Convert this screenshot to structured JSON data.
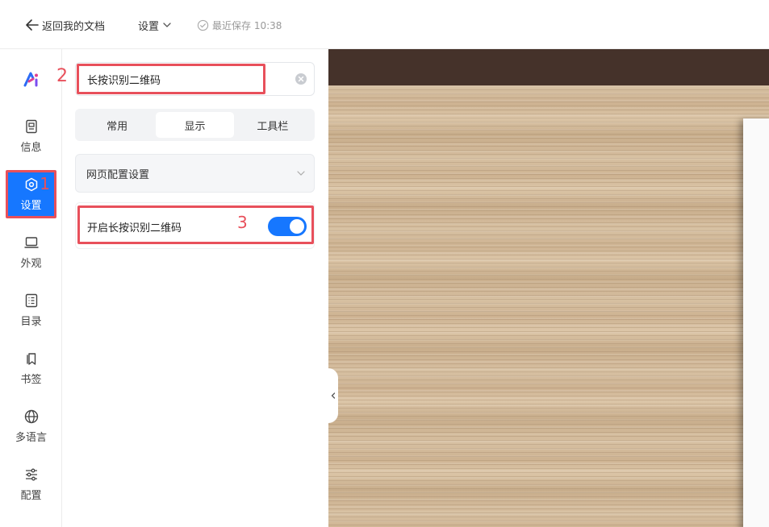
{
  "topbar": {
    "back_label": "返回我的文档",
    "settings_label": "设置",
    "saved_label": "最近保存 10:38"
  },
  "rail": {
    "items": [
      {
        "label": "信息",
        "icon": "info-icon"
      },
      {
        "label": "设置",
        "icon": "settings-icon",
        "active": true
      },
      {
        "label": "外观",
        "icon": "appearance-icon"
      },
      {
        "label": "目录",
        "icon": "toc-icon"
      },
      {
        "label": "书签",
        "icon": "bookmark-icon"
      },
      {
        "label": "多语言",
        "icon": "globe-icon"
      },
      {
        "label": "配置",
        "icon": "sliders-icon"
      }
    ]
  },
  "panel": {
    "search_value": "长按识别二维码",
    "tabs": [
      {
        "label": "常用"
      },
      {
        "label": "显示",
        "active": true
      },
      {
        "label": "工具栏"
      }
    ],
    "section_label": "网页配置设置",
    "option_label": "开启长按识别二维码",
    "option_enabled": true
  },
  "annotations": {
    "step1": "1",
    "step2": "2",
    "step3": "3"
  },
  "colors": {
    "accent": "#1677ff",
    "annotation": "#e8505b",
    "preview_header": "#45322a"
  }
}
